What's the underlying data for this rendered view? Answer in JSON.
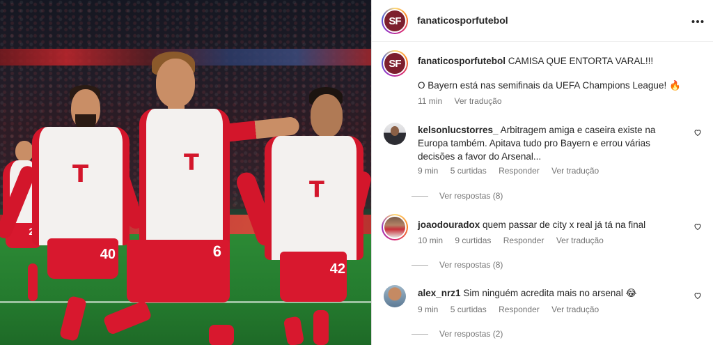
{
  "post": {
    "username": "fanaticosporfutebol",
    "avatar_text": "SF",
    "more_icon": "more-horizontal-icon",
    "caption": {
      "username": "fanaticosporfutebol",
      "text_line1": "CAMISA QUE ENTORTA VARAL!!!",
      "text_line2": "O Bayern está nas semifinais da UEFA Champions League! 🔥",
      "time": "11 min",
      "see_translation": "Ver tradução"
    }
  },
  "photo": {
    "shirt_letter": "T",
    "numbers": [
      "40",
      "6",
      "42",
      "28"
    ],
    "colors": {
      "home_red": "#d3162b",
      "shirt_white": "#f3f1ef",
      "pitch": "#247a2e"
    }
  },
  "comments": [
    {
      "username": "kelsonlucstorres_",
      "text": "Arbitragem amiga e caseira existe na Europa também. Apitava tudo pro Bayern e errou várias decisões a favor do Arsenal...",
      "time": "9 min",
      "likes": "5 curtidas",
      "reply": "Responder",
      "translate": "Ver tradução",
      "view_replies": "Ver respostas (8)"
    },
    {
      "username": "joaodouradox",
      "text": "quem passar de city x real já tá na final",
      "time": "10 min",
      "likes": "9 curtidas",
      "reply": "Responder",
      "translate": "Ver tradução",
      "view_replies": "Ver respostas (8)"
    },
    {
      "username": "alex_nrz1",
      "text": "Sim ninguém acredita mais no arsenal 😂",
      "time": "9 min",
      "likes": "5 curtidas",
      "reply": "Responder",
      "translate": "Ver tradução",
      "view_replies": "Ver respostas (2)"
    }
  ]
}
